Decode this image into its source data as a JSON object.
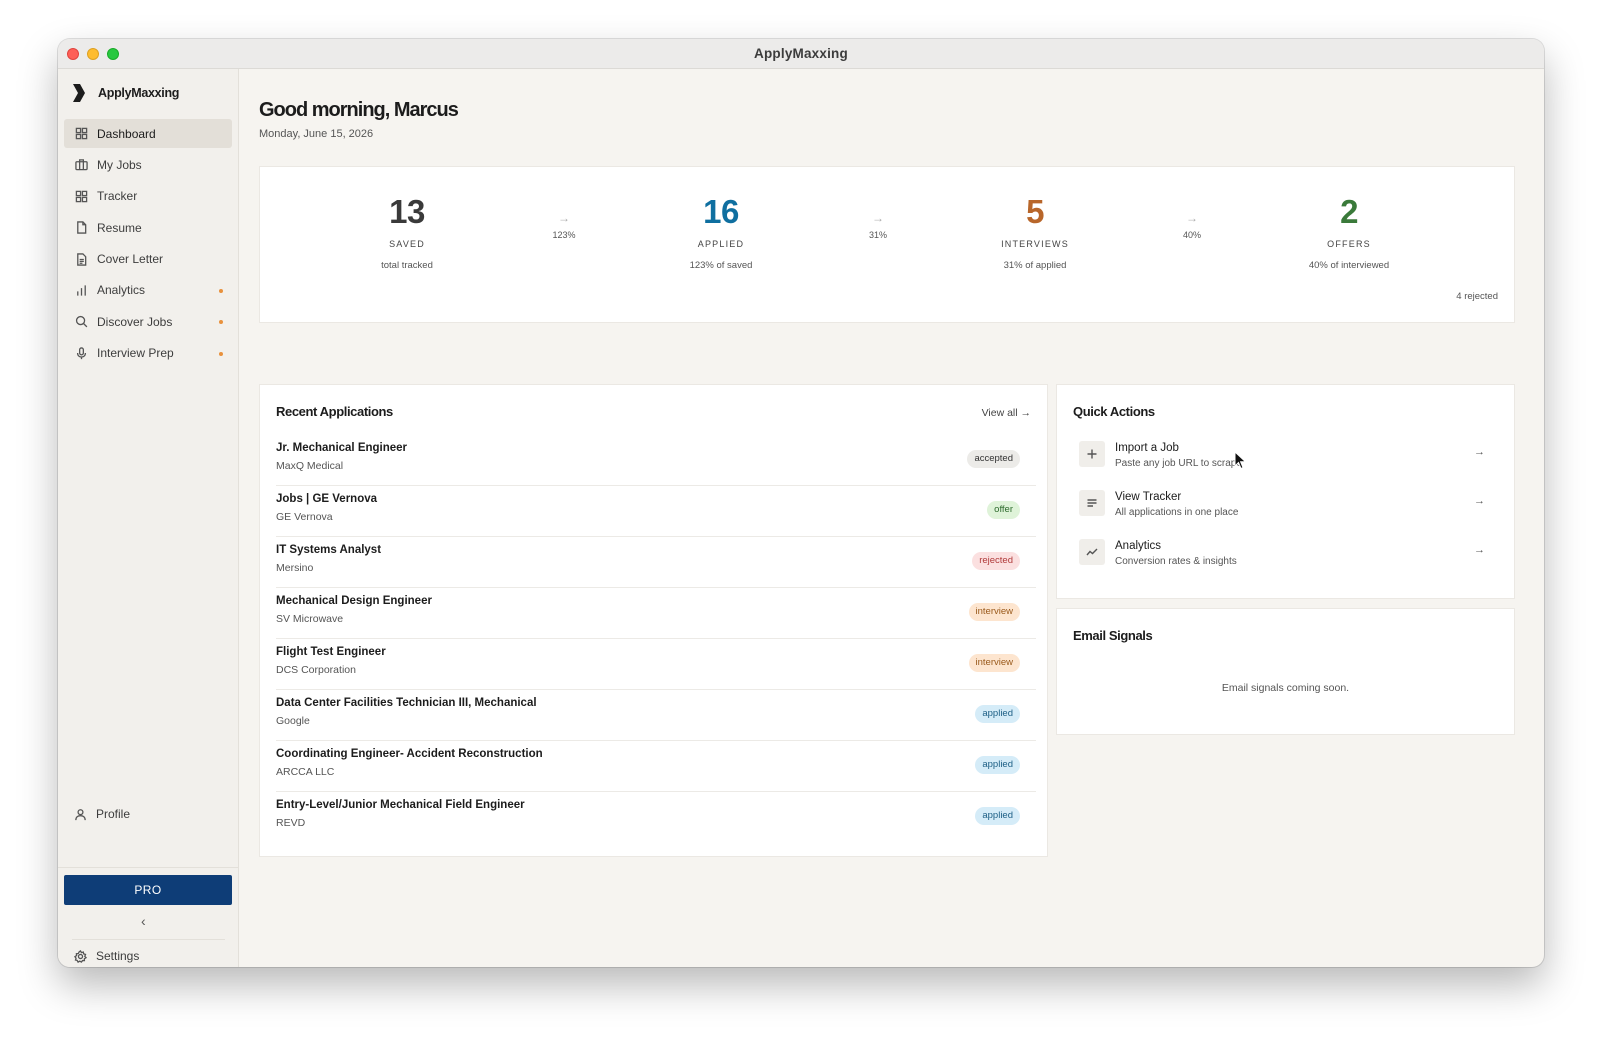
{
  "window": {
    "title": "ApplyMaxxing"
  },
  "sidebar": {
    "brand": "ApplyMaxxing",
    "items": [
      {
        "label": "Dashboard",
        "icon": "grid-icon",
        "active": true,
        "dot": false
      },
      {
        "label": "My Jobs",
        "icon": "briefcase-icon",
        "active": false,
        "dot": false
      },
      {
        "label": "Tracker",
        "icon": "grid-icon",
        "active": false,
        "dot": false
      },
      {
        "label": "Resume",
        "icon": "document-icon",
        "active": false,
        "dot": false
      },
      {
        "label": "Cover Letter",
        "icon": "document-lines-icon",
        "active": false,
        "dot": false
      },
      {
        "label": "Analytics",
        "icon": "bar-chart-icon",
        "active": false,
        "dot": true
      },
      {
        "label": "Discover Jobs",
        "icon": "search-icon",
        "active": false,
        "dot": true
      },
      {
        "label": "Interview Prep",
        "icon": "microphone-icon",
        "active": false,
        "dot": true
      }
    ],
    "profile": "Profile",
    "pro": "PRO",
    "collapse": "‹",
    "settings": "Settings"
  },
  "header": {
    "greeting": "Good morning, Marcus",
    "date": "Monday, June 15, 2026"
  },
  "stats": {
    "saved": {
      "value": "13",
      "label": "SAVED",
      "sub": "total tracked",
      "color": "#3a3a3a"
    },
    "applied": {
      "value": "16",
      "label": "APPLIED",
      "sub": "123% of saved",
      "color": "#0f6fa0"
    },
    "interviews": {
      "value": "5",
      "label": "INTERVIEWS",
      "sub": "31% of applied",
      "color": "#b8662a"
    },
    "offers": {
      "value": "2",
      "label": "OFFERS",
      "sub": "40% of interviewed",
      "color": "#3a7a3a"
    },
    "conversions": [
      "123%",
      "31%",
      "40%"
    ],
    "rejected": "4 rejected"
  },
  "recent": {
    "title": "Recent Applications",
    "view_all": "View all →",
    "rows": [
      {
        "title": "Jr. Mechanical Engineer",
        "company": "MaxQ Medical",
        "status": "accepted"
      },
      {
        "title": "Jobs | GE Vernova",
        "company": "GE Vernova",
        "status": "offer"
      },
      {
        "title": "IT Systems Analyst",
        "company": "Mersino",
        "status": "rejected"
      },
      {
        "title": "Mechanical Design Engineer",
        "company": "SV Microwave",
        "status": "interview"
      },
      {
        "title": "Flight Test Engineer",
        "company": "DCS Corporation",
        "status": "interview"
      },
      {
        "title": "Data Center Facilities Technician III, Mechanical",
        "company": "Google",
        "status": "applied"
      },
      {
        "title": "Coordinating Engineer- Accident Reconstruction",
        "company": "ARCCA LLC",
        "status": "applied"
      },
      {
        "title": "Entry-Level/Junior Mechanical Field Engineer",
        "company": "REVD",
        "status": "applied"
      }
    ],
    "status_colors": {
      "accepted": {
        "bg": "#ecebe8",
        "fg": "#333333"
      },
      "offer": {
        "bg": "#dff3d9",
        "fg": "#2e6b2e"
      },
      "rejected": {
        "bg": "#fbe0e0",
        "fg": "#b03a3a"
      },
      "interview": {
        "bg": "#fde5cf",
        "fg": "#9a5a1c"
      },
      "applied": {
        "bg": "#d5ecf8",
        "fg": "#1d5f85"
      }
    }
  },
  "quick_actions": {
    "title": "Quick Actions",
    "items": [
      {
        "title": "Import a Job",
        "sub": "Paste any job URL to scrape",
        "icon": "plus-icon",
        "arrow": "→"
      },
      {
        "title": "View Tracker",
        "sub": "All applications in one place",
        "icon": "list-icon",
        "arrow": "→"
      },
      {
        "title": "Analytics",
        "sub": "Conversion rates & insights",
        "icon": "trend-icon",
        "arrow": "→"
      }
    ]
  },
  "email_signals": {
    "title": "Email Signals",
    "empty": "Email signals coming soon."
  }
}
